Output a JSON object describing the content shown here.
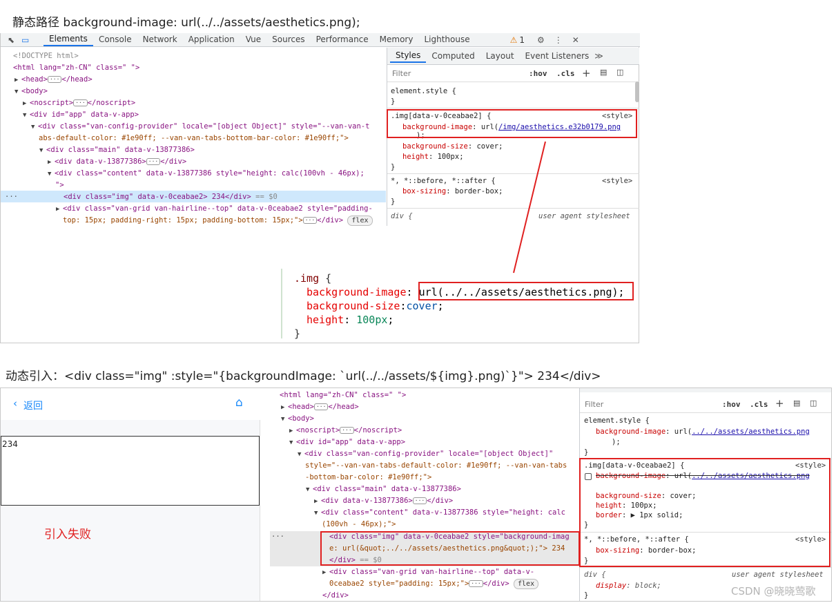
{
  "captions": {
    "static_path": "静态路径  background-image: url(../../assets/aesthetics.png);",
    "dynamic_import": "动态引入：<div class=\"img\" :style=\"{backgroundImage: `url(../../assets/${img}.png)`}\"> 234</div>"
  },
  "devtools_top": {
    "tabs": [
      "Elements",
      "Console",
      "Network",
      "Application",
      "Vue",
      "Sources",
      "Performance",
      "Memory",
      "Lighthouse"
    ],
    "active_tab": "Elements",
    "warning_count": "1",
    "dom_lines": [
      "<!DOCTYPE html>",
      "<html lang=\"zh-CN\" class=\" \">",
      "<head>",
      "</head>",
      "<body>",
      "<noscript>",
      "</noscript>",
      "<div id=\"app\" data-v-app>",
      "<div class=\"van-config-provider\" locale=\"[object Object]\" style=\"--van-van-t",
      "abs-default-color: #1e90ff; --van-van-tabs-bottom-bar-color: #1e90ff;\">",
      "<div class=\"main\" data-v-13877386>",
      "<div data-v-13877386>",
      "</div>",
      "<div class=\"content\" data-v-13877386 style=\"height: calc(100vh - 46px);",
      "\">",
      "<div class=\"img\" data-v-0ceabae2> 234</div>",
      "== $0",
      "<div class=\"van-grid van-hairline--top\" data-v-0ceabae2 style=\"padding-",
      "top: 15px; padding-right: 15px; padding-bottom: 15px;\">",
      "</div>",
      "flex"
    ],
    "styles_tabs": [
      "Styles",
      "Computed",
      "Layout",
      "Event Listeners"
    ],
    "filter_placeholder": "Filter",
    "hov": ":hov",
    "cls": ".cls",
    "element_style": "element.style {",
    "close_brace": "}",
    "rule1_selector": ".img[data-v-0ceabae2] {",
    "style_tag": "<style>",
    "rule1_prop1": "background-image",
    "rule1_url_pre": "url(",
    "rule1_url": "/img/aesthetics.e32b0179.png",
    "rule1_url_post": ");",
    "rule1_prop2": "background-size",
    "rule1_val2": "cover;",
    "rule1_prop3": "height",
    "rule1_val3": "100px;",
    "rule2_selector": "*, *::before, *::after {",
    "rule2_prop": "box-sizing",
    "rule2_val": "border-box;",
    "rule3_selector": "div {",
    "user_agent": "user agent stylesheet"
  },
  "code_snippet": {
    "selector": ".img",
    "open": "{",
    "prop1": "background-image",
    "val1": "url(../../assets/aesthetics.png)",
    "prop2": "background-size",
    "val2": "cover",
    "prop3": "height",
    "val3": "100px",
    "close": "}"
  },
  "app_preview": {
    "back_label": "返回",
    "content_text": "234",
    "annotation": "引入失败"
  },
  "devtools_bottom": {
    "dom_lines": [
      "<html lang=\"zh-CN\" class=\" \">",
      "<head>",
      "</head>",
      "<body>",
      "<noscript>",
      "</noscript>",
      "<div id=\"app\" data-v-app>",
      "<div class=\"van-config-provider\" locale=\"[object Object]\"",
      "style=\"--van-van-tabs-default-color: #1e90ff; --van-van-tabs",
      "-bottom-bar-color: #1e90ff;\">",
      "<div class=\"main\" data-v-13877386>",
      "<div data-v-13877386>",
      "</div>",
      "<div class=\"content\" data-v-13877386 style=\"height: calc",
      "(100vh - 46px);\">",
      "<div class=\"img\" data-v-0ceabae2 style=\"background-imag",
      "e: url(&quot;../../assets/aesthetics.png&quot;);\"> 234",
      "</div>",
      "== $0",
      "<div class=\"van-grid van-hairline--top\" data-v-",
      "0ceabae2 style=\"padding: 15px;\">",
      "</div>",
      "flex",
      "</div>"
    ],
    "filter_placeholder": "Filter",
    "hov": ":hov",
    "cls": ".cls",
    "element_style": "element.style {",
    "es_prop": "background-image",
    "es_url": "../../assets/aesthetics.png",
    "es_post": ");",
    "close_brace": "}",
    "rule1_selector": ".img[data-v-0ceabae2] {",
    "style_tag": "<style>",
    "rule1_prop1": "background-image",
    "rule1_url": "../../assets/aesthetics.png",
    "rule1_prop2": "background-size",
    "rule1_val2": "cover;",
    "rule1_prop3": "height",
    "rule1_val3": "100px;",
    "rule1_prop4": "border",
    "rule1_val4": "1px solid;",
    "rule2_selector": "*, *::before, *::after {",
    "rule2_prop": "box-sizing",
    "rule2_val": "border-box;",
    "rule3_selector": "div {",
    "user_agent": "user agent stylesheet",
    "rule3_prop": "display",
    "rule3_val": "block;"
  },
  "watermark": "CSDN @晓晓莺歌"
}
